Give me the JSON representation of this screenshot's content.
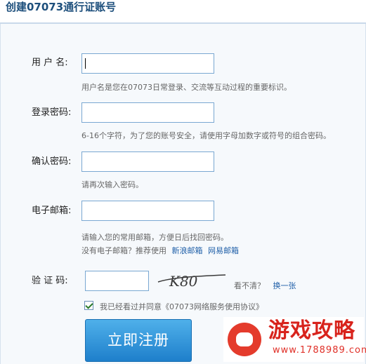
{
  "header": {
    "title": "创建07073通行证账号"
  },
  "form": {
    "username": {
      "label": "用 户 名:",
      "value": "",
      "hint": "用户名是您在07073日常登录、交流等互动过程的重要标识。"
    },
    "password": {
      "label": "登录密码:",
      "value": "",
      "hint": "6-16个字符，为了您的账号安全，请使用字母加数字或符号的组合密码。"
    },
    "confirm": {
      "label": "确认密码:",
      "value": "",
      "hint": "请再次输入密码。"
    },
    "email": {
      "label": "电子邮箱:",
      "value": "",
      "hint": "请输入您的常用邮箱，方便日后找回密码。",
      "no_email_text": "没有电子邮箱？推荐使用",
      "link_sina": "新浪邮箱",
      "link_163": "网易邮箱"
    },
    "captcha": {
      "label": "验 证 码:",
      "value": "",
      "image_text": "K80",
      "unclear": "看不清？",
      "refresh": "换一张"
    },
    "agreement": {
      "checked": true,
      "text": "我已经看过并同意《07073网络服务使用协议》"
    },
    "submit_label": "立即注册"
  },
  "watermark": {
    "title": "游戏攻略",
    "url": "www.1788989.com"
  }
}
